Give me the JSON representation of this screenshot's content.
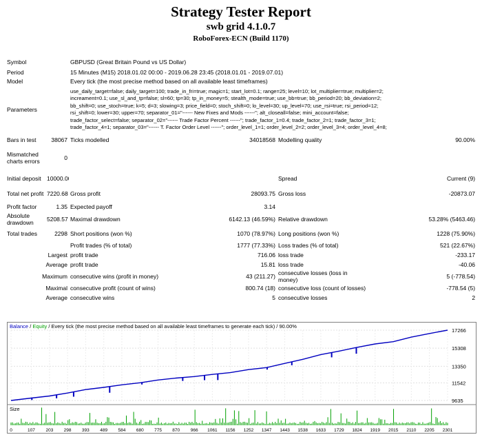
{
  "header": {
    "title": "Strategy Tester Report",
    "ea_name": "swb grid 4.1.0.7",
    "server": "RoboForex-ECN (Build 1170)"
  },
  "info": {
    "symbol_label": "Symbol",
    "symbol_value": "GBPUSD (Great Britain Pound vs US Dollar)",
    "period_label": "Period",
    "period_value": "15 Minutes (M15) 2018.01.02 00:00 - 2019.06.28 23:45 (2018.01.01 - 2019.07.01)",
    "model_label": "Model",
    "model_value": "Every tick (the most precise method based on all available least timeframes)",
    "parameters_label": "Parameters",
    "parameters_lines": [
      "use_daily_target=false; daily_target=100; trade_in_fri=true; magic=1; start_lot=0.1; range=25; level=10; lot_multiplier=true; multiplier=2;",
      "increament=0.1; use_sl_and_tp=false; sl=60; tp=30; tp_in_money=5; stealth_mode=true; use_bb=true; bb_period=20; bb_deviation=2;",
      "bb_shift=0; use_stoch=true; k=5; d=3; slowing=3; price_field=0; stoch_shift=0; lo_level=30; up_level=70; use_rsi=true; rsi_period=12;",
      "rsi_shift=0; lower=30; upper=70; separator_01=\"------ New Fixes and Mods ------\"; alt_closeall=false; mini_account=false;",
      "trade_factor_select=false; separator_02=\"------ Trade Factor Percent ------\"; trade_factor_1=0.4; trade_factor_2=1; trade_factor_3=1;",
      "trade_factor_4=1; separator_03=\"------ T. Factor Order Level ------\"; order_level_1=1; order_level_2=2; order_level_3=4; order_level_4=8;"
    ]
  },
  "stats": {
    "bars_label": "Bars in test",
    "bars_value": "38067",
    "ticks_label": "Ticks modelled",
    "ticks_value": "34018568",
    "quality_label": "Modelling quality",
    "quality_value": "90.00%",
    "mismatch_label": "Mismatched charts errors",
    "mismatch_value": "0",
    "deposit_label": "Initial deposit",
    "deposit_value": "10000.00",
    "spread_label": "Spread",
    "spread_value": "Current (9)",
    "netprofit_label": "Total net profit",
    "netprofit_value": "7220.68",
    "grossprofit_label": "Gross profit",
    "grossprofit_value": "28093.75",
    "grossloss_label": "Gross loss",
    "grossloss_value": "-20873.07",
    "pf_label": "Profit factor",
    "pf_value": "1.35",
    "payoff_label": "Expected payoff",
    "payoff_value": "3.14",
    "absdd_label": "Absolute drawdown",
    "absdd_value": "5208.57",
    "maxdd_label": "Maximal drawdown",
    "maxdd_value": "6142.13 (46.59%)",
    "reldd_label": "Relative drawdown",
    "reldd_value": "53.28% (5463.46)",
    "trades_label": "Total trades",
    "trades_value": "2298",
    "short_label": "Short positions (won %)",
    "short_value": "1070 (78.97%)",
    "long_label": "Long positions (won %)",
    "long_value": "1228 (75.90%)",
    "ptrades_label": "Profit trades (% of total)",
    "ptrades_value": "1777 (77.33%)",
    "ltrades_label": "Loss trades (% of total)",
    "ltrades_value": "521 (22.67%)",
    "largest_label": "Largest",
    "largest_profit_label": "profit trade",
    "largest_profit_value": "716.06",
    "largest_loss_label": "loss trade",
    "largest_loss_value": "-233.17",
    "average_label": "Average",
    "average_profit_label": "profit trade",
    "average_profit_value": "15.81",
    "average_loss_label": "loss trade",
    "average_loss_value": "-40.06",
    "maximum_label": "Maximum",
    "max_wins_label": "consecutive wins (profit in money)",
    "max_wins_value": "43 (211.27)",
    "max_losses_label": "consecutive losses (loss in money)",
    "max_losses_value": "5 (-778.54)",
    "maximal_label": "Maximal",
    "maximal_profit_label": "consecutive profit (count of wins)",
    "maximal_profit_value": "800.74 (18)",
    "maximal_loss_label": "consecutive loss (count of losses)",
    "maximal_loss_value": "-778.54 (5)",
    "avgcons_label": "Average",
    "avg_wins_label": "consecutive wins",
    "avg_wins_value": "5",
    "avg_losses_label": "consecutive losses",
    "avg_losses_value": "2"
  },
  "chart_caption": {
    "balance": "Balance",
    "sep": " / ",
    "equity": "Equity",
    "rest": " / Every tick (the most precise method based on all available least timeframes to generate each tick) / 90.00%"
  },
  "chart_data": {
    "type": "line",
    "series": [
      {
        "name": "Balance",
        "x": [
          0,
          107,
          203,
          298,
          393,
          489,
          584,
          680,
          775,
          870,
          966,
          1061,
          1156,
          1252,
          1347,
          1443,
          1538,
          1633,
          1729,
          1824,
          1919,
          2015,
          2110,
          2205,
          2301
        ],
        "values": [
          9635,
          9900,
          10120,
          10440,
          10820,
          11060,
          11330,
          11560,
          11860,
          12070,
          12230,
          12460,
          12660,
          12990,
          13200,
          13660,
          14100,
          14620,
          14990,
          15400,
          15770,
          16020,
          16510,
          16900,
          17266
        ]
      }
    ],
    "y_ticks": [
      "17266",
      "15308",
      "13350",
      "11542",
      "9635"
    ],
    "x_ticks": [
      "0",
      "107",
      "203",
      "298",
      "393",
      "489",
      "584",
      "680",
      "775",
      "870",
      "966",
      "1061",
      "1156",
      "1252",
      "1347",
      "1443",
      "1538",
      "1633",
      "1729",
      "1824",
      "1919",
      "2015",
      "2110",
      "2205",
      "2301"
    ],
    "ylim": [
      9635,
      17266
    ],
    "xlim": [
      0,
      2301
    ],
    "size_label": "Size",
    "colors": {
      "balance": "#0000c0",
      "equity": "#00a000",
      "size": "#00a000"
    }
  }
}
